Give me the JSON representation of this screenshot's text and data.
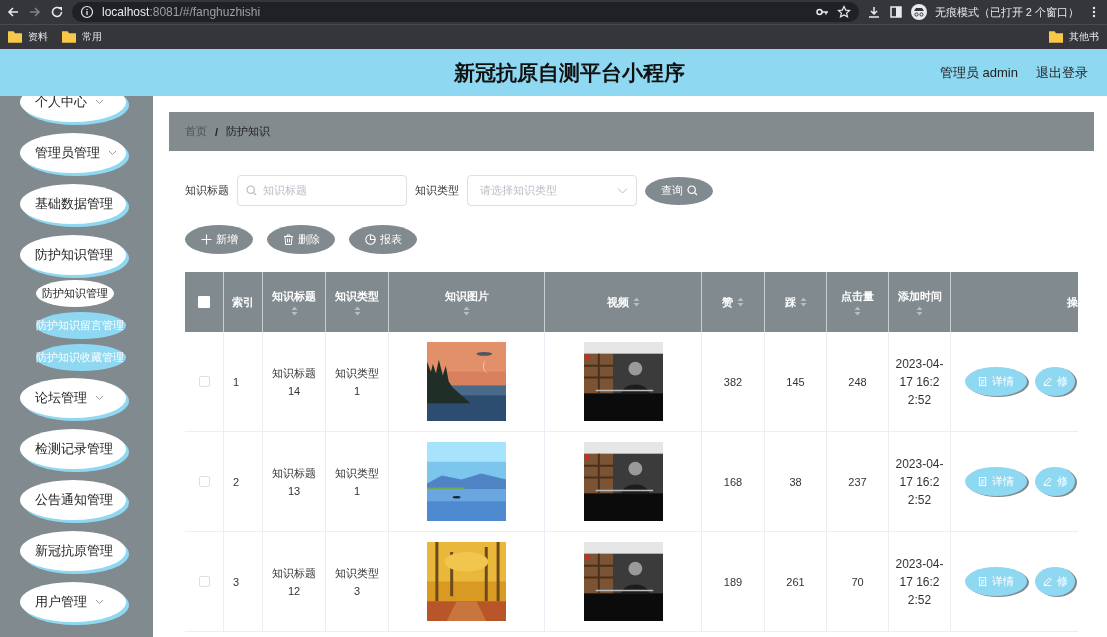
{
  "browser": {
    "url_host": "localhost",
    "url_path": ":8081/#/fanghuzhishi",
    "incognito_label": "无痕模式（已打开 2 个窗口）",
    "bookmarks": [
      {
        "label": "资料"
      },
      {
        "label": "常用"
      }
    ],
    "other_bookmarks": "其他书"
  },
  "header": {
    "title": "新冠抗原自测平台小程序",
    "user": "管理员 admin",
    "logout": "退出登录"
  },
  "sidebar": {
    "items": [
      {
        "label": "个人中心",
        "kind": "submenu"
      },
      {
        "label": "管理员管理",
        "kind": "submenu"
      },
      {
        "label": "基础数据管理",
        "kind": "group"
      },
      {
        "label": "防护知识管理",
        "kind": "group",
        "children": [
          {
            "label": "防护知识管理",
            "selected": true
          },
          {
            "label": "防护知识留言管理",
            "selected": false
          },
          {
            "label": "防护知识收藏管理",
            "selected": false
          }
        ]
      },
      {
        "label": "论坛管理",
        "kind": "submenu"
      },
      {
        "label": "检测记录管理",
        "kind": "group"
      },
      {
        "label": "公告通知管理",
        "kind": "group"
      },
      {
        "label": "新冠抗原管理",
        "kind": "group"
      },
      {
        "label": "用户管理",
        "kind": "submenu"
      }
    ]
  },
  "breadcrumb": {
    "separator": "/",
    "items": [
      {
        "label": "首页",
        "current": false
      },
      {
        "label": "防护知识",
        "current": true
      }
    ]
  },
  "filters": [
    {
      "label": "知识标题",
      "kind": "input",
      "placeholder": "知识标题"
    },
    {
      "label": "知识类型",
      "kind": "select",
      "placeholder": "请选择知识类型"
    }
  ],
  "search_button": "查询",
  "actions": [
    {
      "label": "新增"
    },
    {
      "label": "删除"
    },
    {
      "label": "报表"
    }
  ],
  "table": {
    "columns": [
      {
        "kind": "checkbox",
        "checked": false
      },
      {
        "kind": "text",
        "label": "索引",
        "sortable": false
      },
      {
        "kind": "text",
        "label": "知识标题",
        "sortable": true
      },
      {
        "kind": "text",
        "label": "知识类型",
        "sortable": true
      },
      {
        "kind": "text",
        "label": "知识图片",
        "sortable": true
      },
      {
        "kind": "text",
        "label": "视频",
        "sortable": true
      },
      {
        "kind": "text",
        "label": "赞",
        "sortable": true
      },
      {
        "kind": "text",
        "label": "踩",
        "sortable": true
      },
      {
        "kind": "text",
        "label": "点击量",
        "sortable": true
      },
      {
        "kind": "text",
        "label": "添加时间",
        "sortable": true
      },
      {
        "kind": "text",
        "label": "操",
        "sortable": false
      }
    ],
    "rows": [
      {
        "checked": false,
        "index": "1",
        "title": "知识标题14",
        "type": "知识类型1",
        "likes": "382",
        "dislikes": "145",
        "clicks": "248",
        "added": "2023-04-17 16:22:52",
        "actions": [
          {
            "label": "详情"
          },
          {
            "label": "修"
          }
        ]
      },
      {
        "checked": false,
        "index": "2",
        "title": "知识标题13",
        "type": "知识类型1",
        "likes": "168",
        "dislikes": "38",
        "clicks": "237",
        "added": "2023-04-17 16:22:52",
        "actions": [
          {
            "label": "详情"
          },
          {
            "label": "修"
          }
        ]
      },
      {
        "checked": false,
        "index": "3",
        "title": "知识标题12",
        "type": "知识类型3",
        "likes": "189",
        "dislikes": "261",
        "clicks": "70",
        "added": "2023-04-17 16:22:52",
        "actions": [
          {
            "label": "详情"
          },
          {
            "label": "修"
          }
        ]
      }
    ]
  }
}
